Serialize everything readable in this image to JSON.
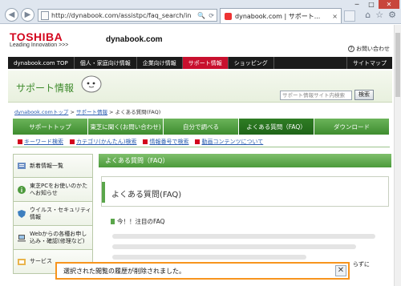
{
  "browser": {
    "url": "http://dynabook.com/assistpc/faq_search/in",
    "tab_title": "dynabook.com | サポート...",
    "tab_close": "×",
    "back_icon": "◀",
    "forward_icon": "▶",
    "window_controls": {
      "minimize": "─",
      "maximize": "□",
      "close": "✕"
    },
    "tools_icons": [
      "🔍",
      "⟳"
    ],
    "right_icons": [
      "⌂",
      "☆",
      "⚙"
    ]
  },
  "header": {
    "logo": "TOSHIBA",
    "tagline": "Leading Innovation >>>",
    "brand": "dynabook.com",
    "contact_icon": "?",
    "contact": "お問い合わせ"
  },
  "global_nav": {
    "items": [
      {
        "label": "dynabook.com TOP"
      },
      {
        "label": "個人・家庭向け情報"
      },
      {
        "label": "企業向け情報"
      },
      {
        "label": "サポート情報",
        "active": true
      },
      {
        "label": "ショッピング"
      }
    ],
    "sitemap": "サイトマップ"
  },
  "support": {
    "title": "サポート情報",
    "search_placeholder": "サポート情報サイト内検索",
    "search_button": "検索"
  },
  "breadcrumb": {
    "home": "dynabook.comトップ",
    "sep1": " > ",
    "support": "サポート情報",
    "sep2": " > ",
    "current": "よくある質問(FAQ)"
  },
  "tabs": [
    {
      "label": "サポートトップ"
    },
    {
      "label": "東芝に聞く(お問い合わせ)"
    },
    {
      "label": "自分で調べる"
    },
    {
      "label": "よくある質問（FAQ）",
      "active": true
    },
    {
      "label": "ダウンロード"
    }
  ],
  "subnav": [
    {
      "label": "キーワード検索"
    },
    {
      "label": "カテゴリ(かんたん)検索"
    },
    {
      "label": "情報番号で検索"
    },
    {
      "label": "動画コンテンツについて"
    }
  ],
  "sidebar": {
    "items": [
      {
        "label": "新着情報一覧"
      },
      {
        "label": "東芝PCをお使いのかたへお知らせ"
      },
      {
        "label": "ウイルス・セキュリティ情報"
      },
      {
        "label": "Webからの各種お申し込み・確認(修理など)"
      },
      {
        "label": "サービス"
      }
    ]
  },
  "main": {
    "bar_title": "よくある質問（FAQ）",
    "box_title": "よくある質問(FAQ)",
    "notice_title": "今！！注目のFAQ",
    "trailing": "らずに"
  },
  "notification": {
    "message": "選択された閲覧の履歴が削除されました。",
    "close": "✕"
  },
  "colors": {
    "accent_red": "#d3061d",
    "green": "#3e8c2f",
    "notify_border": "#f7941d"
  }
}
